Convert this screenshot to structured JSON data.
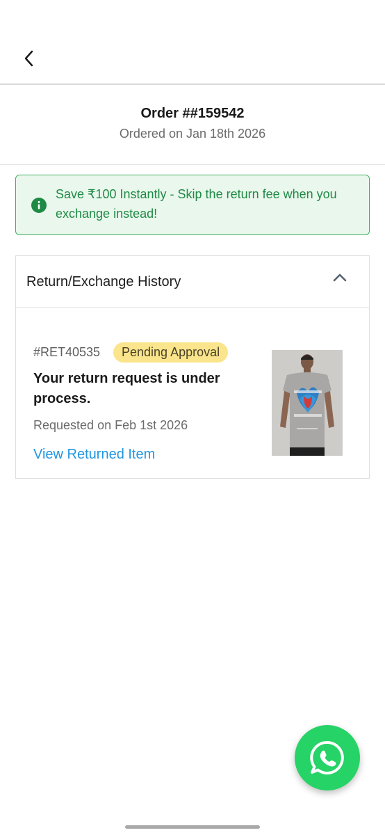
{
  "header": {
    "back_icon": "chevron-left-icon"
  },
  "order": {
    "title": "Order ##159542",
    "ordered_on": "Ordered on Jan 18th 2026"
  },
  "promo": {
    "icon": "info-icon",
    "text": "Save ₹100 Instantly - Skip the return fee when you exchange instead!",
    "accent_color": "#1f8a45",
    "background_color": "#e9f7ec"
  },
  "history": {
    "title": "Return/Exchange History",
    "toggle_icon": "chevron-up-icon",
    "item": {
      "return_id": "#RET40535",
      "status": "Pending Approval",
      "status_color": "#fbe58c",
      "message": "Your return request is under process.",
      "requested_on": "Requested on Feb 1st 2026",
      "link_label": "View Returned Item",
      "link_color": "#2196e0",
      "image_icon": "product-tshirt-image"
    }
  },
  "fab": {
    "icon": "whatsapp-icon",
    "color": "#25d366"
  }
}
